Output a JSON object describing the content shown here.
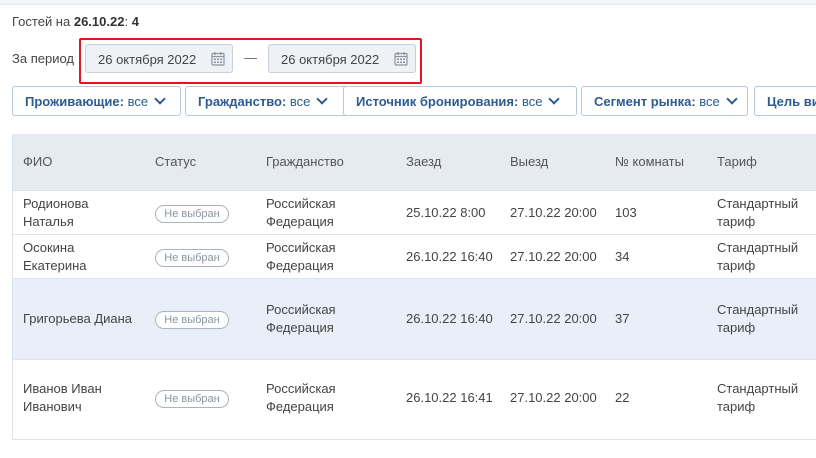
{
  "summary": {
    "prefix": "Гостей на ",
    "date": "26.10.22",
    "sep": ": ",
    "count": "4"
  },
  "period": {
    "label": "За период",
    "from": "26 октября 2022",
    "to": "26 октября 2022",
    "dash": "—"
  },
  "filters": [
    {
      "label": "Проживающие:",
      "value": "все"
    },
    {
      "label": "Гражданство:",
      "value": "все"
    },
    {
      "label": "Источник бронирования:",
      "value": "все"
    },
    {
      "label": "Сегмент рынка:",
      "value": "все"
    },
    {
      "label": "Цель ви",
      "value": ""
    }
  ],
  "table": {
    "columns": [
      "ФИО",
      "Статус",
      "Гражданство",
      "Заезд",
      "Выезд",
      "№ комнаты",
      "Тариф"
    ],
    "rows": [
      {
        "name1": "Родионова",
        "name2": "Наталья",
        "status": "Не выбран",
        "cit1": "Российская",
        "cit2": "Федерация",
        "checkin": "25.10.22 8:00",
        "checkout": "27.10.22 20:00",
        "room": "103",
        "tar1": "Стандартный",
        "tar2": "тариф"
      },
      {
        "name1": "Осокина",
        "name2": "Екатерина",
        "status": "Не выбран",
        "cit1": "Российская",
        "cit2": "Федерация",
        "checkin": "26.10.22 16:40",
        "checkout": "27.10.22 20:00",
        "room": "34",
        "tar1": "Стандартный",
        "tar2": "тариф"
      },
      {
        "name1": "Григорьева Диана",
        "name2": "",
        "status": "Не выбран",
        "cit1": "Российская",
        "cit2": "Федерация",
        "checkin": "26.10.22 16:40",
        "checkout": "27.10.22 20:00",
        "room": "37",
        "tar1": "Стандартный",
        "tar2": "тариф"
      },
      {
        "name1": "Иванов Иван",
        "name2": "Иванович",
        "status": "Не выбран",
        "cit1": "Российская",
        "cit2": "Федерация",
        "checkin": "26.10.22 16:41",
        "checkout": "27.10.22 20:00",
        "room": "22",
        "tar1": "Стандартный",
        "tar2": "тариф"
      }
    ]
  },
  "colors": {
    "accent": "#2e5b91",
    "highlight": "#e0171e",
    "header_bg": "#e6ebf1",
    "row_hover": "#e8eff8"
  },
  "icons": {
    "calendar": "calendar-icon",
    "chevron": "chevron-down-icon"
  }
}
